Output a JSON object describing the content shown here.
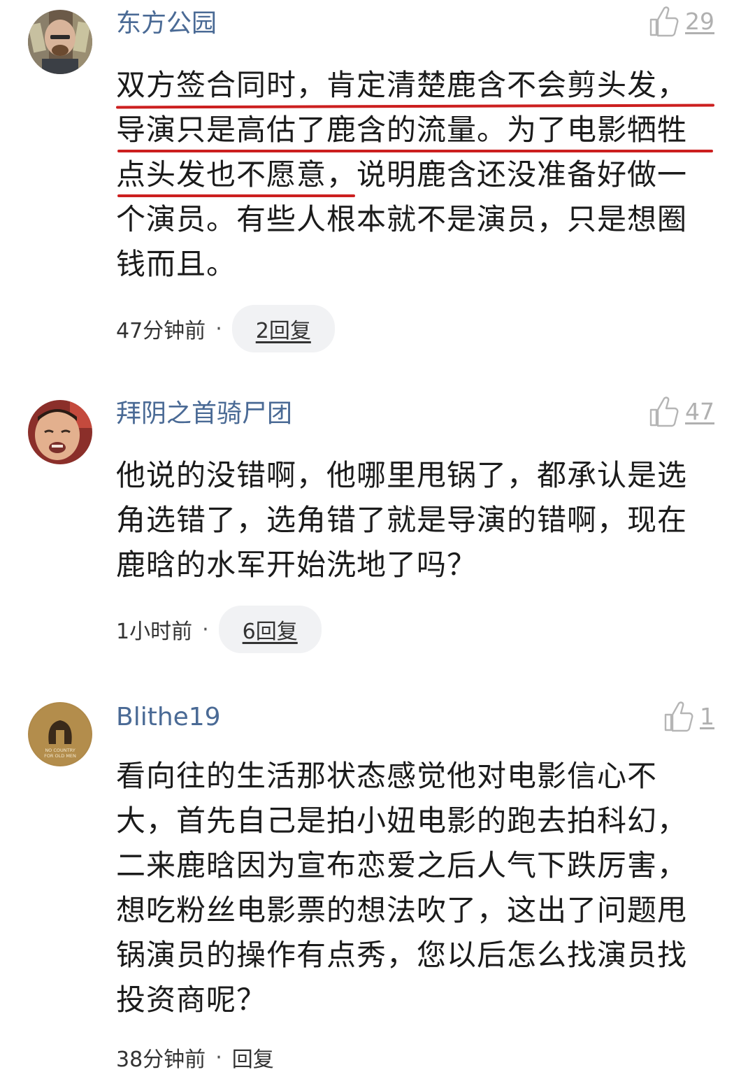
{
  "comments": [
    {
      "username": "东方公园",
      "likes": "29",
      "avatar": "bald-man-portrait",
      "lines": [
        "双方签合同时，肯定清楚鹿含不会剪头发，",
        "导演只是高估了鹿含的流量。为了电影牺牲",
        "点头发也不愿意，说明鹿含还没准备好做一",
        "个演员。有些人根本就不是演员，只是想圈",
        "钱而且。"
      ],
      "time": "47分钟前",
      "reply": "2回复"
    },
    {
      "username": "拜阴之首骑尸团",
      "likes": "47",
      "avatar": "crying-baby-portrait",
      "lines": [
        "他说的没错啊，他哪里甩锅了，都承认是选",
        "角选错了，选角错了就是导演的错啊，现在",
        "鹿晗的水军开始洗地了吗？"
      ],
      "time": "1小时前",
      "reply": "6回复"
    },
    {
      "username": "Blithe19",
      "likes": "1",
      "avatar": "no-country-for-old-men-poster",
      "avatar_text": [
        "NO COUNTRY",
        "FOR OLD MEN"
      ],
      "lines": [
        "看向往的生活那状态感觉他对电影信心不",
        "大，首先自己是拍小妞电影的跑去拍科幻，",
        "二来鹿晗因为宣布恋爱之后人气下跌厉害，",
        "想吃粉丝电影票的想法吹了，这出了问题甩",
        "锅演员的操作有点秀，您以后怎么找演员找",
        "投资商呢？"
      ],
      "time": "38分钟前",
      "reply": "回复"
    }
  ],
  "colors": {
    "username": "#4a6a95",
    "underline_annotation": "#cc1f1f",
    "like": "#b0b0b0",
    "pill_bg": "#f1f2f4"
  },
  "icons": [
    "thumbs-up-icon"
  ]
}
